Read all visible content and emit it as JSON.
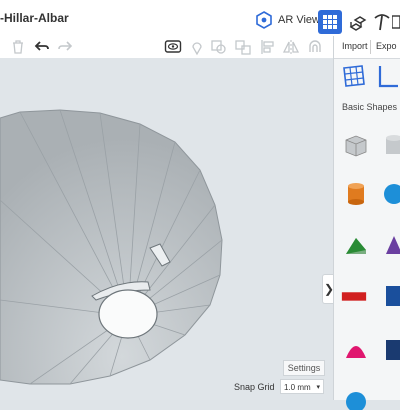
{
  "header": {
    "title": "-Hillar-Albar",
    "ar_viewer_label": "AR Viewer"
  },
  "panel": {
    "import_label": "Import",
    "export_label": "Expo",
    "basic_shapes_label": "Basic Shapes"
  },
  "viewport": {
    "settings_label": "Settings",
    "snap_grid_label": "Snap Grid",
    "snap_grid_value": "1.0 mm"
  },
  "colors": {
    "accent": "#2f6bd8",
    "cone": "#c2c8cc",
    "viewport_bg": "#e0e5e9"
  }
}
